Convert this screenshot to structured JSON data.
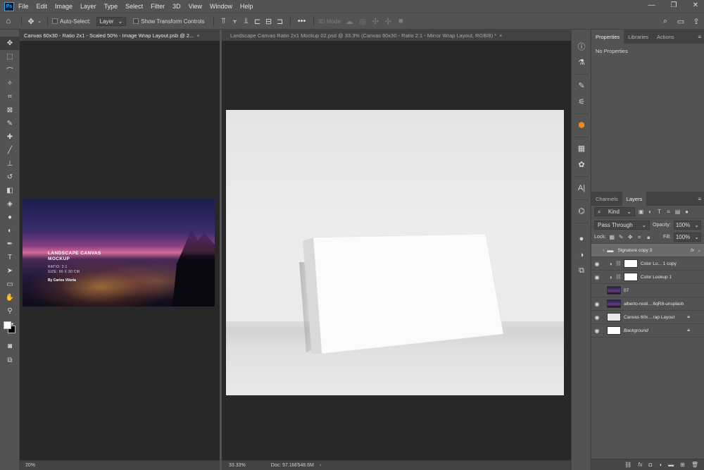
{
  "menu": [
    "File",
    "Edit",
    "Image",
    "Layer",
    "Type",
    "Select",
    "Filter",
    "3D",
    "View",
    "Window",
    "Help"
  ],
  "app_logo": "Ps",
  "options": {
    "auto_select_label": "Auto-Select:",
    "auto_select_value": "Layer",
    "transform_label": "Show Transform Controls",
    "mode_3d_label": "3D Mode:"
  },
  "documents": [
    {
      "tab": "Canvas 60x30 - Ratio 2x1 - Scaled 50% - Image Wrap Layout.psb @ 2...",
      "zoom": "20%",
      "title_line1": "LANDSCAPE CANVAS",
      "title_line2": "MOCKUP",
      "ratio": "RATIO: 2:1",
      "size": "SIZE: 60 X 30 CM",
      "author": "By Carlos Viloria"
    },
    {
      "tab": "Landscape Canvas Ratio 2x1 Mockup 02.psd @ 33.3% (Canvas 60x30 - Ratio 2:1 - Mirror Wrap Layout, RGB/8) *",
      "zoom": "33.33%",
      "doc_info": "Doc: 57.1M/548.6M"
    }
  ],
  "properties_panel": {
    "tabs": [
      "Properties",
      "Libraries",
      "Actions"
    ],
    "body": "No Properties"
  },
  "layers_panel": {
    "tabs": [
      "Channels",
      "Layers"
    ],
    "filter_kind": "Kind",
    "blend_mode": "Pass Through",
    "opacity_label": "Opacity:",
    "opacity_value": "100%",
    "lock_label": "Lock:",
    "fill_label": "Fill:",
    "fill_value": "100%",
    "fx_label": "fx",
    "layers": [
      {
        "name": "Signature copy 3",
        "type": "group"
      },
      {
        "name": "Color Lo... 1 copy",
        "type": "adjustment"
      },
      {
        "name": "Color Lookup 1",
        "type": "adjustment"
      },
      {
        "name": "07",
        "type": "image"
      },
      {
        "name": "alberto-resti....6qR8-unsplash",
        "type": "image"
      },
      {
        "name": "Canvas 60x....rap Layout",
        "type": "smart"
      },
      {
        "name": "Background",
        "type": "background"
      }
    ]
  }
}
